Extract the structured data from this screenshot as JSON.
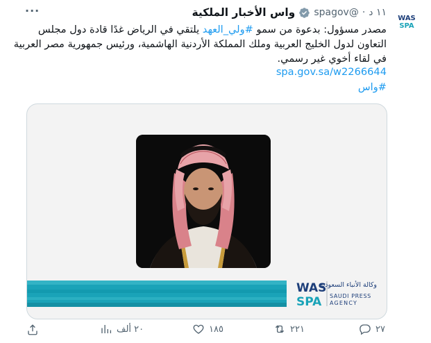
{
  "author": {
    "name": "واس الأخبار الملكية",
    "handle": "@spagov",
    "separator": "·",
    "time": "١١ د"
  },
  "more_label": "···",
  "tweet": {
    "text_before": "مصدر مسؤول: بدعوة من سمو ",
    "text_hashtag": "#ولي_العهد",
    "text_after": " يلتقي في الرياض غدًا قادة دول مجلس التعاون لدول الخليج العربية وملك المملكة الأردنية الهاشمية، ورئيس جمهورية مصر العربية في لقاء أخوي غير رسمي.",
    "link": "spa.gov.sa/w2266644",
    "hashtag": "#واس"
  },
  "media": {
    "logo_arabic": "وكالة الأنباء السعودية",
    "logo_english_1": "SAUDI PRESS",
    "logo_english_2": "AGENCY",
    "banner_color": "#1aa3b8"
  },
  "actions": {
    "replies": "٢٧",
    "retweets": "٢٢١",
    "likes": "١٨٥",
    "views": "٢٠ ألف"
  },
  "icons": [
    "spa-logo-icon",
    "verified-icon",
    "more-icon",
    "reply-icon",
    "retweet-icon",
    "like-icon",
    "views-icon",
    "share-icon"
  ],
  "colors": {
    "accent": "#1d9bf0",
    "muted": "#536471",
    "brand_teal": "#1aa3b8",
    "brand_blue": "#1e3f7a"
  }
}
